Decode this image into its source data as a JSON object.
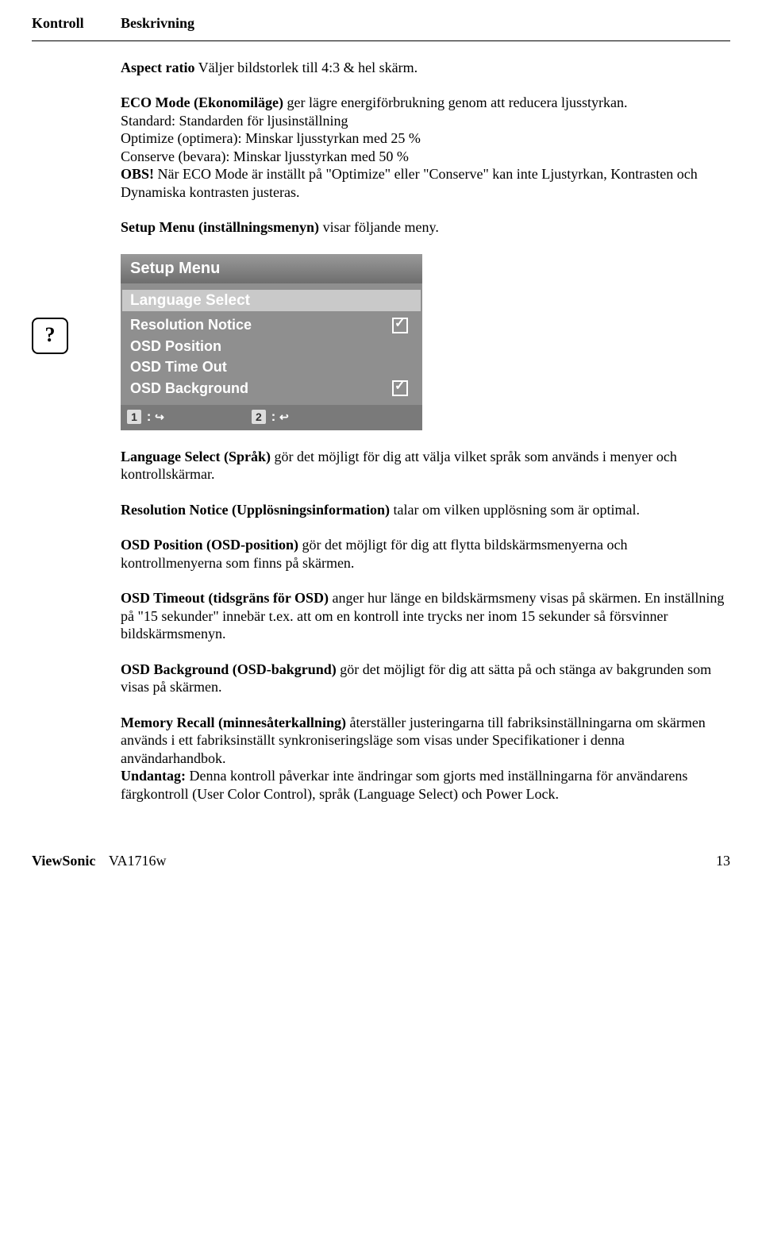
{
  "header": {
    "kontroll": "Kontroll",
    "beskrivning": "Beskrivning"
  },
  "icon": {
    "glyph": "?"
  },
  "p1": {
    "b": "Aspect ratio",
    "rest": " Väljer bildstorlek till 4:3 & hel skärm."
  },
  "p2": {
    "b": "ECO Mode (Ekonomiläge)",
    "rest": " ger lägre energiförbrukning genom att reducera ljusstyrkan.",
    "l3": "Standard: Standarden för ljusinställning",
    "l4": "Optimize (optimera): Minskar ljusstyrkan med 25 %",
    "l5": "Conserve (bevara): Minskar ljusstyrkan med 50 %",
    "l6b": "OBS!",
    "l6": " När ECO Mode är inställt på \"Optimize\" eller \"Conserve\" kan inte Ljustyrkan, Kontrasten och Dynamiska kontrasten justeras."
  },
  "p3": {
    "b": "Setup Menu (inställningsmenyn)",
    "rest": " visar följande meny."
  },
  "osd": {
    "title": "Setup Menu",
    "highlight": "Language Select",
    "items": {
      "resolution": "Resolution Notice",
      "position": "OSD Position",
      "timeout": "OSD Time Out",
      "background": "OSD Background"
    },
    "footer1_num": "1",
    "footer1_rest": " : ",
    "footer2_num": "2",
    "footer2_rest": " : "
  },
  "p4": {
    "b": "Language Select (Språk)",
    "rest": " gör det möjligt för dig att välja vilket språk som används i menyer och kontrollskärmar."
  },
  "p5": {
    "b": "Resolution Notice (Upplösningsinformation)",
    "rest": " talar om vilken upplösning som är optimal."
  },
  "p6": {
    "b": "OSD Position (OSD-position)",
    "rest": " gör det möjligt för dig att flytta bildskärmsmenyerna och kontrollmenyerna som finns på skärmen."
  },
  "p7": {
    "b": "OSD Timeout (tidsgräns för OSD)",
    "rest": " anger hur länge en bildskärmsmeny visas på skärmen. En inställning på \"15 sekunder\" innebär t.ex. att om en kontroll inte trycks ner inom 15 sekunder så försvinner bildskärmsmenyn."
  },
  "p8": {
    "b": "OSD Background (OSD-bakgrund)",
    "rest": " gör det möjligt för dig att sätta på och stänga av bakgrunden som visas på skärmen."
  },
  "p9": {
    "b": "Memory Recall (minnesåterkallning)",
    "rest": " återställer justeringarna till fabriksinställningarna om skärmen används i ett fabriksinställt synkroniseringsläge som visas under Specifikationer i denna användarhandbok.",
    "b2": "Undantag:",
    "rest2": " Denna kontroll påverkar inte ändringar som gjorts med inställningarna för användarens färgkontroll (User Color Control), språk (Language Select) och Power Lock."
  },
  "footer": {
    "brand": "ViewSonic",
    "model": "VA1716w",
    "page": "13"
  }
}
